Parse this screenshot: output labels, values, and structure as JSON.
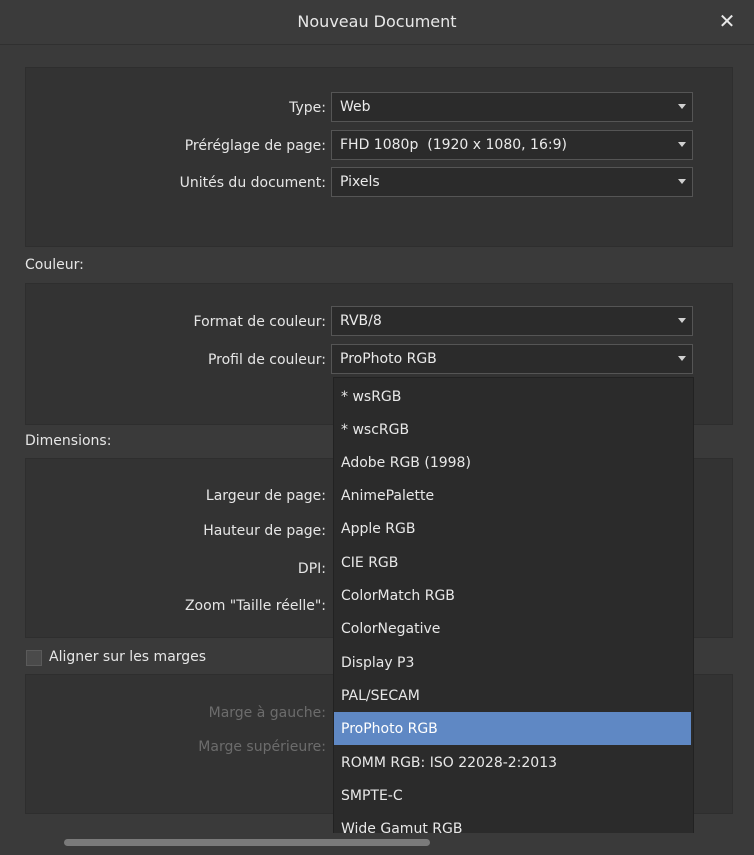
{
  "window": {
    "title": "Nouveau Document"
  },
  "document": {
    "type_label": "Type:",
    "type_value": "Web",
    "preset_label": "Préréglage de page:",
    "preset_value": "FHD 1080p  (1920 x 1080, 16:9)",
    "units_label": "Unités du document:",
    "units_value": "Pixels"
  },
  "color": {
    "section_label": "Couleur:",
    "format_label": "Format de couleur:",
    "format_value": "RVB/8",
    "profile_label": "Profil de couleur:",
    "profile_value": "ProPhoto RGB"
  },
  "dimensions": {
    "section_label": "Dimensions:",
    "width_label": "Largeur de page:",
    "height_label": "Hauteur de page:",
    "dpi_label": "DPI:",
    "zoom_label": "Zoom \"Taille réelle\":"
  },
  "margins": {
    "checkbox_label": "Aligner sur les marges",
    "left_label": "Marge à gauche:",
    "top_label": "Marge supérieure:"
  },
  "profile_options": [
    "* wsRGB",
    "* wscRGB",
    "Adobe RGB (1998)",
    "AnimePalette",
    "Apple RGB",
    "CIE RGB",
    "ColorMatch RGB",
    "ColorNegative",
    "Display P3",
    "PAL/SECAM",
    "ProPhoto RGB",
    "ROMM RGB: ISO 22028-2:2013",
    "SMPTE-C",
    "Wide Gamut RGB"
  ],
  "selected_profile": "ProPhoto RGB",
  "colors": {
    "selection": "#5f88c4",
    "background": "#3a3a3a"
  },
  "icons": {
    "close": "close-icon",
    "caret": "caret-down-icon"
  }
}
